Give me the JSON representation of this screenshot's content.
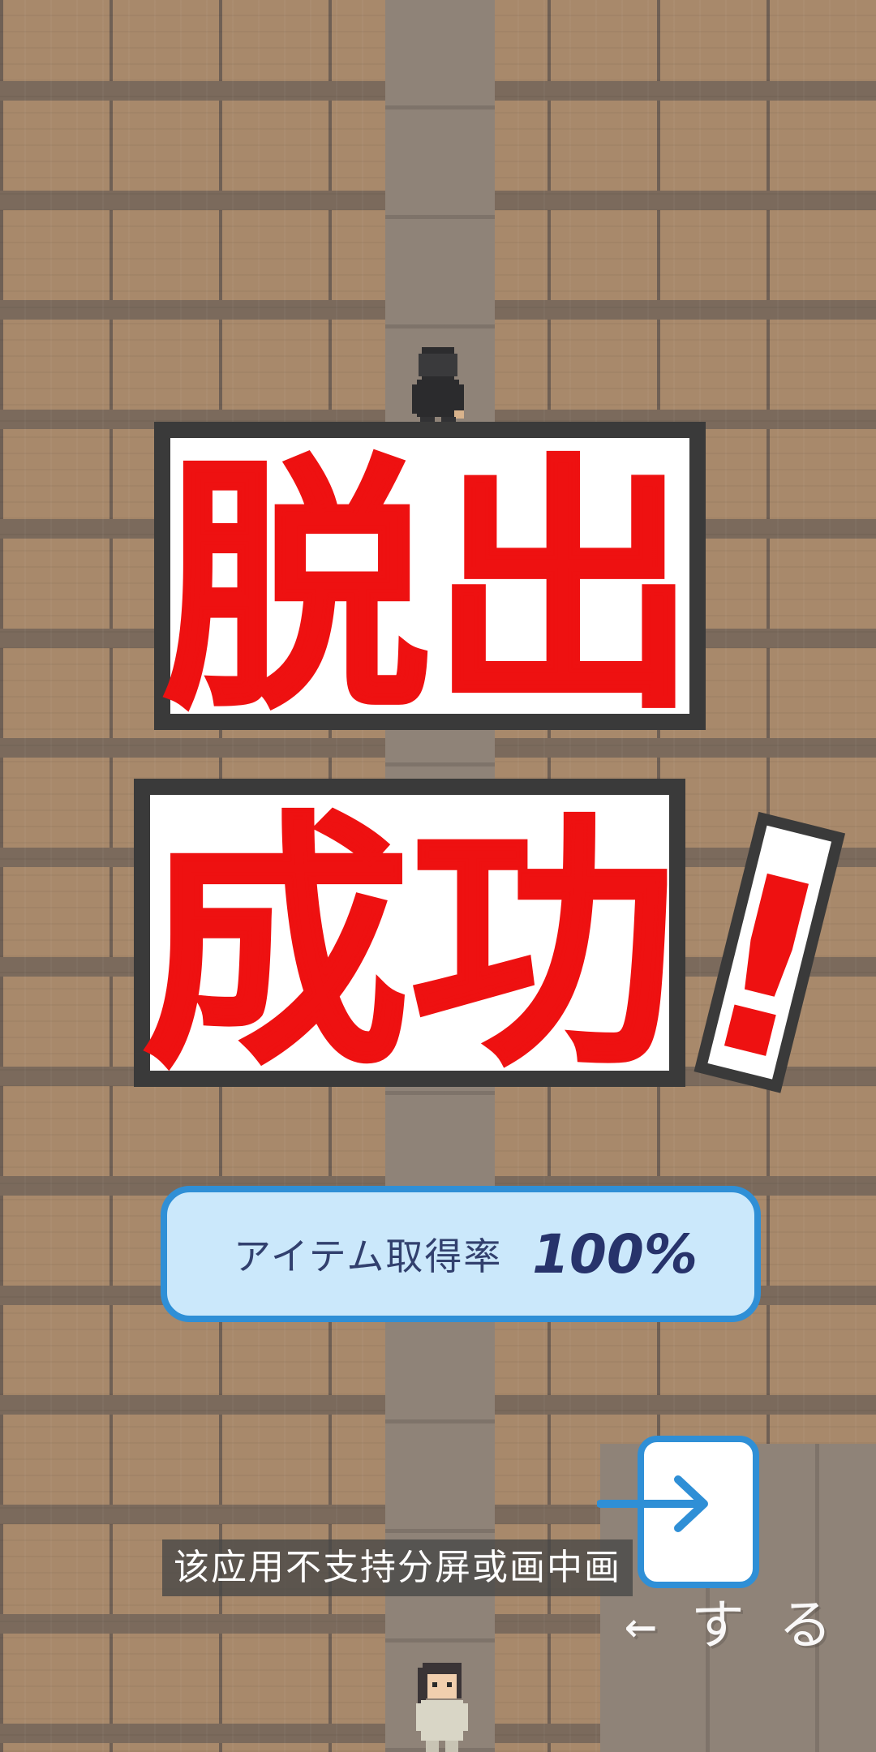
{
  "title": {
    "line1": "脱出",
    "line2": "成功",
    "exclamation": "!"
  },
  "result": {
    "label": "アイテム取得率",
    "value": "100%"
  },
  "exit_button": {
    "icon": "arrow-right-icon"
  },
  "hint_text": "←する",
  "toast": {
    "message": "该应用不支持分屏或画中画"
  },
  "colors": {
    "title_fill": "#ee1111",
    "title_outline": "#3a3a3a",
    "panel_fill": "#cbe8fb",
    "panel_border": "#2f8fd6",
    "floor": "#a8896b",
    "aisle": "#8f8378"
  }
}
